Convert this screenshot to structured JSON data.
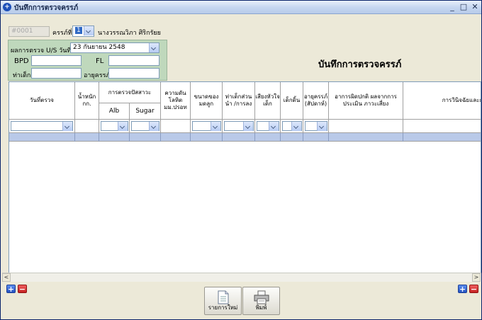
{
  "window": {
    "title": "บันทึกการตรวจครรภ์"
  },
  "header": {
    "hn_value": "#0001",
    "pregnancy_label": "ครรภ์ที่",
    "pregnancy_value": "1",
    "patient_name": "นางวรรณวิภา ศิริกรัยย"
  },
  "us_panel": {
    "exam_label": "ผลการตรวจ U/S วันที่",
    "exam_date": "23  กันยายน    2548",
    "bpd_label": "BPD",
    "fl_label": "FL",
    "position_label": "ท่าเด็ก",
    "ga_label": "อายุครรภ์"
  },
  "page_title": "บันทึกการตรวจครรภ์",
  "grid": {
    "headers": {
      "date": "วันที่ตรวจ",
      "weight": "น้ำหนัก กก.",
      "urine": "การตรวจปัสสาวะ",
      "alb": "Alb",
      "sugar": "Sugar",
      "bp": "ความดัน โลหิต มม.ปรอท",
      "fundus": "ขนาดของ มดลูก",
      "presentation": "ท่าเด็กส่วนนำ /การลง",
      "fhs": "เสียงหัวใจ เด็ก",
      "movement": "เด็กดิ้น",
      "ga": "อายุครรภ์ (สัปดาห์)",
      "symptoms": "อาการผิดปกติ ผลจากการประเมิน ภาวะเสี่ยง",
      "diagnosis": "การวินิจฉัยและการรักษา"
    }
  },
  "buttons": {
    "new_list": "รายการใหม่",
    "print": "พิมพ์"
  },
  "icons": {
    "plus": "+",
    "minus": "−",
    "minimize": "_",
    "maximize": "□",
    "close": "✕",
    "scroll_left": "<",
    "scroll_right": ">"
  }
}
